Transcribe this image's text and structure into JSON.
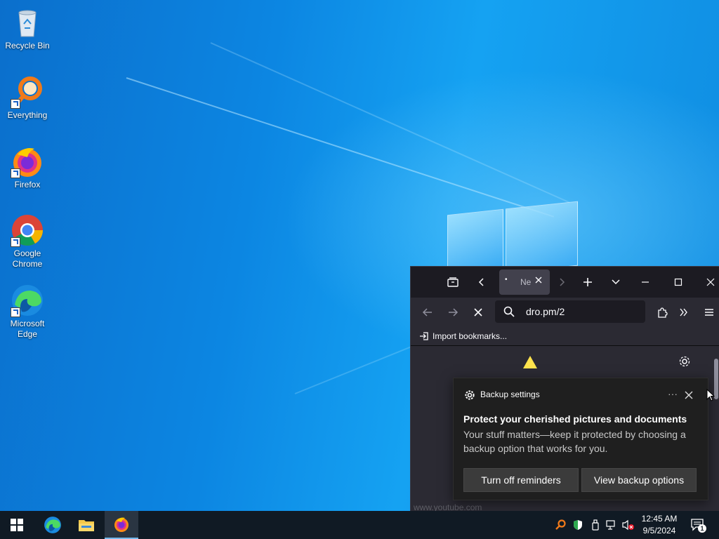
{
  "desktop": {
    "icons": [
      {
        "label": "Recycle Bin"
      },
      {
        "label": "Everything"
      },
      {
        "label": "Firefox"
      },
      {
        "label": "Google Chrome"
      },
      {
        "label": "Microsoft Edge"
      }
    ]
  },
  "browser": {
    "tab_title": "Ne",
    "url": "dro.pm/2",
    "bookmarks_import": "Import bookmarks...",
    "status_url": "www.youtube.com"
  },
  "notification": {
    "header": "Backup settings",
    "title": "Protect your cherished pictures and documents",
    "body": "Your stuff matters—keep it protected by choosing a backup option that works for you.",
    "btn_turn_off": "Turn off reminders",
    "btn_view": "View backup options",
    "more": "···"
  },
  "taskbar": {
    "time": "12:45 AM",
    "date": "9/5/2024",
    "notification_count": "1"
  },
  "colors": {
    "desktop_blue": "#0a78d7",
    "browser_dark": "#1c1b22",
    "taskbar": "#101a24"
  }
}
